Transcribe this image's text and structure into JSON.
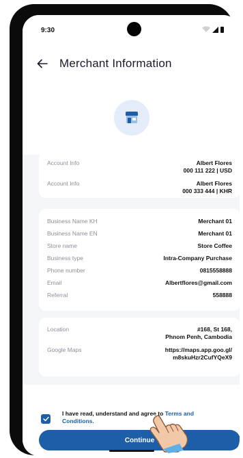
{
  "status_bar": {
    "time": "9:30"
  },
  "header": {
    "title": "Merchant Information",
    "back_icon": "arrow-left-icon"
  },
  "hero": {
    "icon": "store-icon"
  },
  "account_card": {
    "rows": [
      {
        "label": "Account Info",
        "value_line1": "Albert Flores",
        "value_line2": "000 111 222 | USD"
      },
      {
        "label": "Account Info",
        "value_line1": "Albert Flores",
        "value_line2": "000 333 444 | KHR"
      }
    ]
  },
  "business_card": {
    "rows": [
      {
        "label": "Business Name KH",
        "value": "Merchant 01"
      },
      {
        "label": "Business Name EN",
        "value": "Merchant 01"
      },
      {
        "label": "Store name",
        "value": "Store Coffee"
      },
      {
        "label": "Business type",
        "value": "Intra-Company Purchase"
      },
      {
        "label": "Phone number",
        "value": "0815558888"
      },
      {
        "label": "Email",
        "value": "Albertflores@gmail.com"
      },
      {
        "label": "Referral",
        "value": "558888"
      }
    ]
  },
  "location_card": {
    "rows": [
      {
        "label": "Location",
        "value_line1": "#168, St 168,",
        "value_line2": "Phnom Penh, Cambodia"
      },
      {
        "label": "Google Maps",
        "value_line1": "https://maps.app.goo.gl/",
        "value_line2": "m8skuHzr2CufYQeX9"
      }
    ]
  },
  "footer": {
    "terms_prefix": "I have read, understand and agree to ",
    "terms_link": "Terms and Conditions.",
    "continue_label": "Continue",
    "checkbox_checked": true
  },
  "colors": {
    "primary": "#1c5fa8",
    "background": "#f4f5f8"
  }
}
